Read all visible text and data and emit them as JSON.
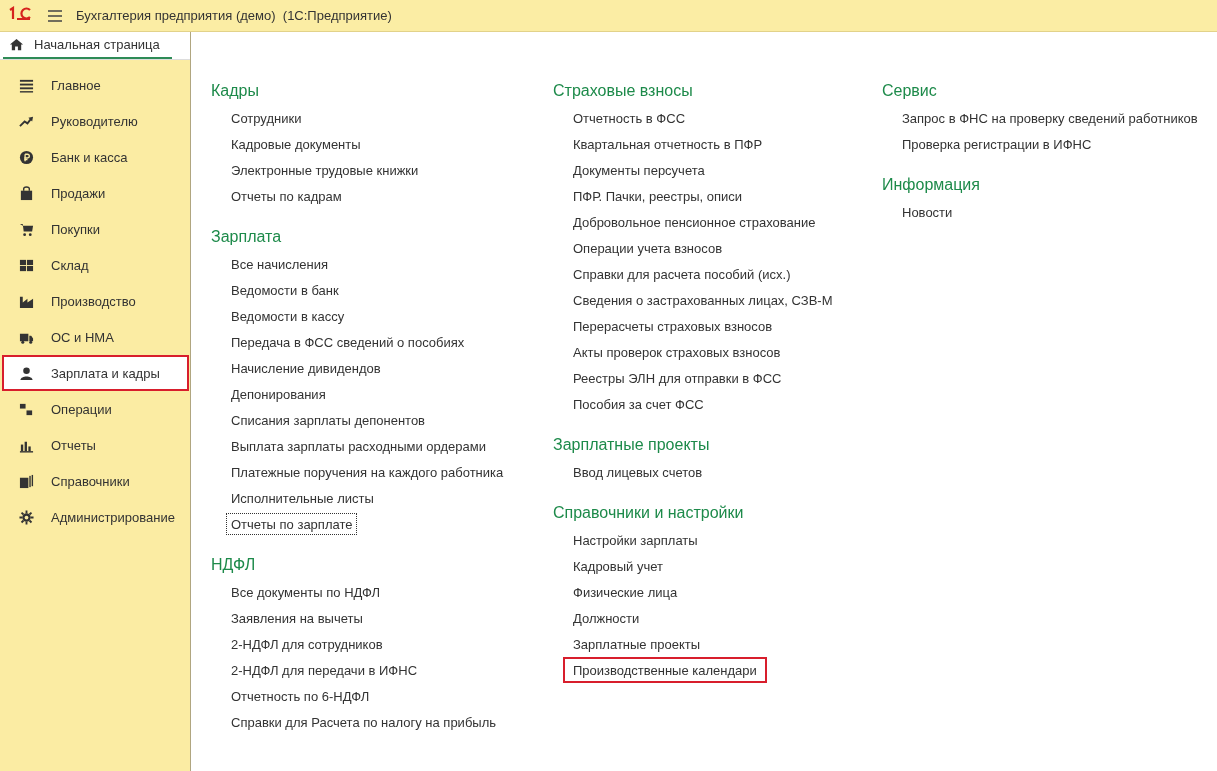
{
  "window": {
    "title": "Бухгалтерия предприятия (демо)  (1С:Предприятие)"
  },
  "home_tab": {
    "label": "Начальная страница",
    "selected": true
  },
  "sidebar": {
    "items": [
      {
        "label": "Главное",
        "kind": "list",
        "selected": false
      },
      {
        "label": "Руководителю",
        "kind": "trend",
        "selected": false
      },
      {
        "label": "Банк и касса",
        "kind": "ruble",
        "selected": false
      },
      {
        "label": "Продажи",
        "kind": "bag",
        "selected": false
      },
      {
        "label": "Покупки",
        "kind": "cart",
        "selected": false
      },
      {
        "label": "Склад",
        "kind": "grid",
        "selected": false
      },
      {
        "label": "Производство",
        "kind": "factory",
        "selected": false
      },
      {
        "label": "ОС и НМА",
        "kind": "truck",
        "selected": false
      },
      {
        "label": "Зарплата и кадры",
        "kind": "person",
        "selected": true
      },
      {
        "label": "Операции",
        "kind": "dtkt",
        "selected": false
      },
      {
        "label": "Отчеты",
        "kind": "bars",
        "selected": false
      },
      {
        "label": "Справочники",
        "kind": "books",
        "selected": false
      },
      {
        "label": "Администрирование",
        "kind": "gear",
        "selected": false
      }
    ]
  },
  "columns": [
    {
      "sections": [
        {
          "title": "Кадры",
          "links": [
            {
              "label": "Сотрудники",
              "focused": false,
              "marked": false
            },
            {
              "label": "Кадровые документы",
              "focused": false,
              "marked": false
            },
            {
              "label": "Электронные трудовые книжки",
              "focused": false,
              "marked": false
            },
            {
              "label": "Отчеты по кадрам",
              "focused": false,
              "marked": false
            }
          ]
        },
        {
          "title": "Зарплата",
          "links": [
            {
              "label": "Все начисления",
              "focused": false,
              "marked": false
            },
            {
              "label": "Ведомости в банк",
              "focused": false,
              "marked": false
            },
            {
              "label": "Ведомости в кассу",
              "focused": false,
              "marked": false
            },
            {
              "label": "Передача в ФСС сведений о пособиях",
              "focused": false,
              "marked": false
            },
            {
              "label": "Начисление дивидендов",
              "focused": false,
              "marked": false
            },
            {
              "label": "Депонирования",
              "focused": false,
              "marked": false
            },
            {
              "label": "Списания зарплаты депонентов",
              "focused": false,
              "marked": false
            },
            {
              "label": "Выплата зарплаты расходными ордерами",
              "focused": false,
              "marked": false
            },
            {
              "label": "Платежные поручения на каждого работника",
              "focused": false,
              "marked": false
            },
            {
              "label": "Исполнительные листы",
              "focused": false,
              "marked": false
            },
            {
              "label": "Отчеты по зарплате",
              "focused": true,
              "marked": false
            }
          ]
        },
        {
          "title": "НДФЛ",
          "links": [
            {
              "label": "Все документы по НДФЛ",
              "focused": false,
              "marked": false
            },
            {
              "label": "Заявления на вычеты",
              "focused": false,
              "marked": false
            },
            {
              "label": "2-НДФЛ для сотрудников",
              "focused": false,
              "marked": false
            },
            {
              "label": "2-НДФЛ для передачи в ИФНС",
              "focused": false,
              "marked": false
            },
            {
              "label": "Отчетность по 6-НДФЛ",
              "focused": false,
              "marked": false
            },
            {
              "label": "Справки для Расчета по налогу на прибыль",
              "focused": false,
              "marked": false
            }
          ]
        }
      ]
    },
    {
      "sections": [
        {
          "title": "Страховые взносы",
          "links": [
            {
              "label": "Отчетность в ФСС",
              "focused": false,
              "marked": false
            },
            {
              "label": "Квартальная отчетность в ПФР",
              "focused": false,
              "marked": false
            },
            {
              "label": "Документы персучета",
              "focused": false,
              "marked": false
            },
            {
              "label": "ПФР. Пачки, реестры, описи",
              "focused": false,
              "marked": false
            },
            {
              "label": "Добровольное пенсионное страхование",
              "focused": false,
              "marked": false
            },
            {
              "label": "Операции учета взносов",
              "focused": false,
              "marked": false
            },
            {
              "label": "Справки для расчета пособий (исх.)",
              "focused": false,
              "marked": false
            },
            {
              "label": "Сведения о застрахованных лицах, СЗВ-М",
              "focused": false,
              "marked": false
            },
            {
              "label": "Перерасчеты страховых взносов",
              "focused": false,
              "marked": false
            },
            {
              "label": "Акты проверок страховых взносов",
              "focused": false,
              "marked": false
            },
            {
              "label": "Реестры ЭЛН для отправки в ФСС",
              "focused": false,
              "marked": false
            },
            {
              "label": "Пособия за счет ФСС",
              "focused": false,
              "marked": false
            }
          ]
        },
        {
          "title": "Зарплатные проекты",
          "links": [
            {
              "label": "Ввод лицевых счетов",
              "focused": false,
              "marked": false
            }
          ]
        },
        {
          "title": "Справочники и настройки",
          "links": [
            {
              "label": "Настройки зарплаты",
              "focused": false,
              "marked": false
            },
            {
              "label": "Кадровый учет",
              "focused": false,
              "marked": false
            },
            {
              "label": "Физические лица",
              "focused": false,
              "marked": false
            },
            {
              "label": "Должности",
              "focused": false,
              "marked": false
            },
            {
              "label": "Зарплатные проекты",
              "focused": false,
              "marked": false
            },
            {
              "label": "Производственные календари",
              "focused": false,
              "marked": true
            }
          ]
        }
      ]
    },
    {
      "sections": [
        {
          "title": "Сервис",
          "links": [
            {
              "label": "Запрос в ФНС на проверку сведений работников",
              "focused": false,
              "marked": false
            },
            {
              "label": "Проверка регистрации в ИФНС",
              "focused": false,
              "marked": false
            }
          ]
        },
        {
          "title": "Информация",
          "links": [
            {
              "label": "Новости",
              "focused": false,
              "marked": false
            }
          ]
        }
      ]
    }
  ]
}
